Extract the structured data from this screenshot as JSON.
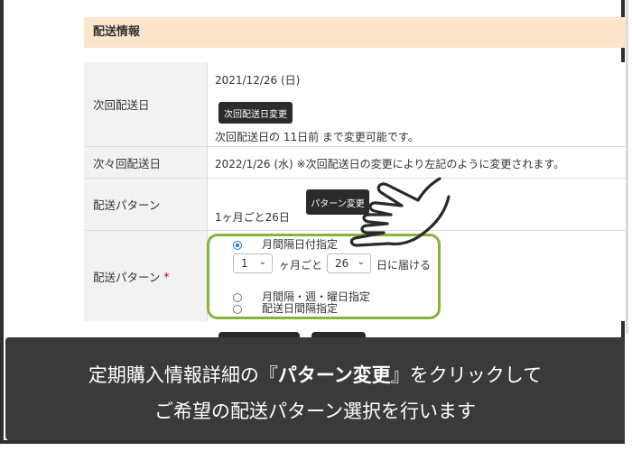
{
  "section": {
    "title": "配送情報"
  },
  "rows": {
    "next_delivery": {
      "label": "次回配送日",
      "date": "2021/12/26 (日)",
      "button": "次回配送日変更",
      "note": "次回配送日の 11日前 まで変更可能です。"
    },
    "following_delivery": {
      "label": "次々回配送日",
      "value": "2022/1/26 (水) ※次回配送日の変更により左記のように変更されます。"
    },
    "delivery_pattern": {
      "label": "配送パターン",
      "value": "1ヶ月ごと26日",
      "button": "パターン変更"
    },
    "pattern_select": {
      "label": "配送パターン",
      "required_mark": "*",
      "option1": "月間隔日付指定",
      "month_value": "1",
      "month_suffix": "ヶ月ごと",
      "day_value": "26",
      "day_suffix": "日に届ける",
      "option2": "月間隔・週・曜日指定",
      "option3": "配送日間隔指定"
    }
  },
  "caption": {
    "line1_pre": "定期購入情報詳細の『",
    "line1_bold": "パターン変更",
    "line1_post": "』をクリックして",
    "line2": "ご希望の配送パターン選択を行います"
  },
  "colors": {
    "header_bg": "#fbe6cc",
    "highlight_border": "#88b33a",
    "caption_bg": "#3a3a3a",
    "button_bg": "#2b2b2b",
    "required": "#d0021b"
  },
  "icons": [
    "pointing-hand-icon",
    "chevron-down-icon"
  ]
}
